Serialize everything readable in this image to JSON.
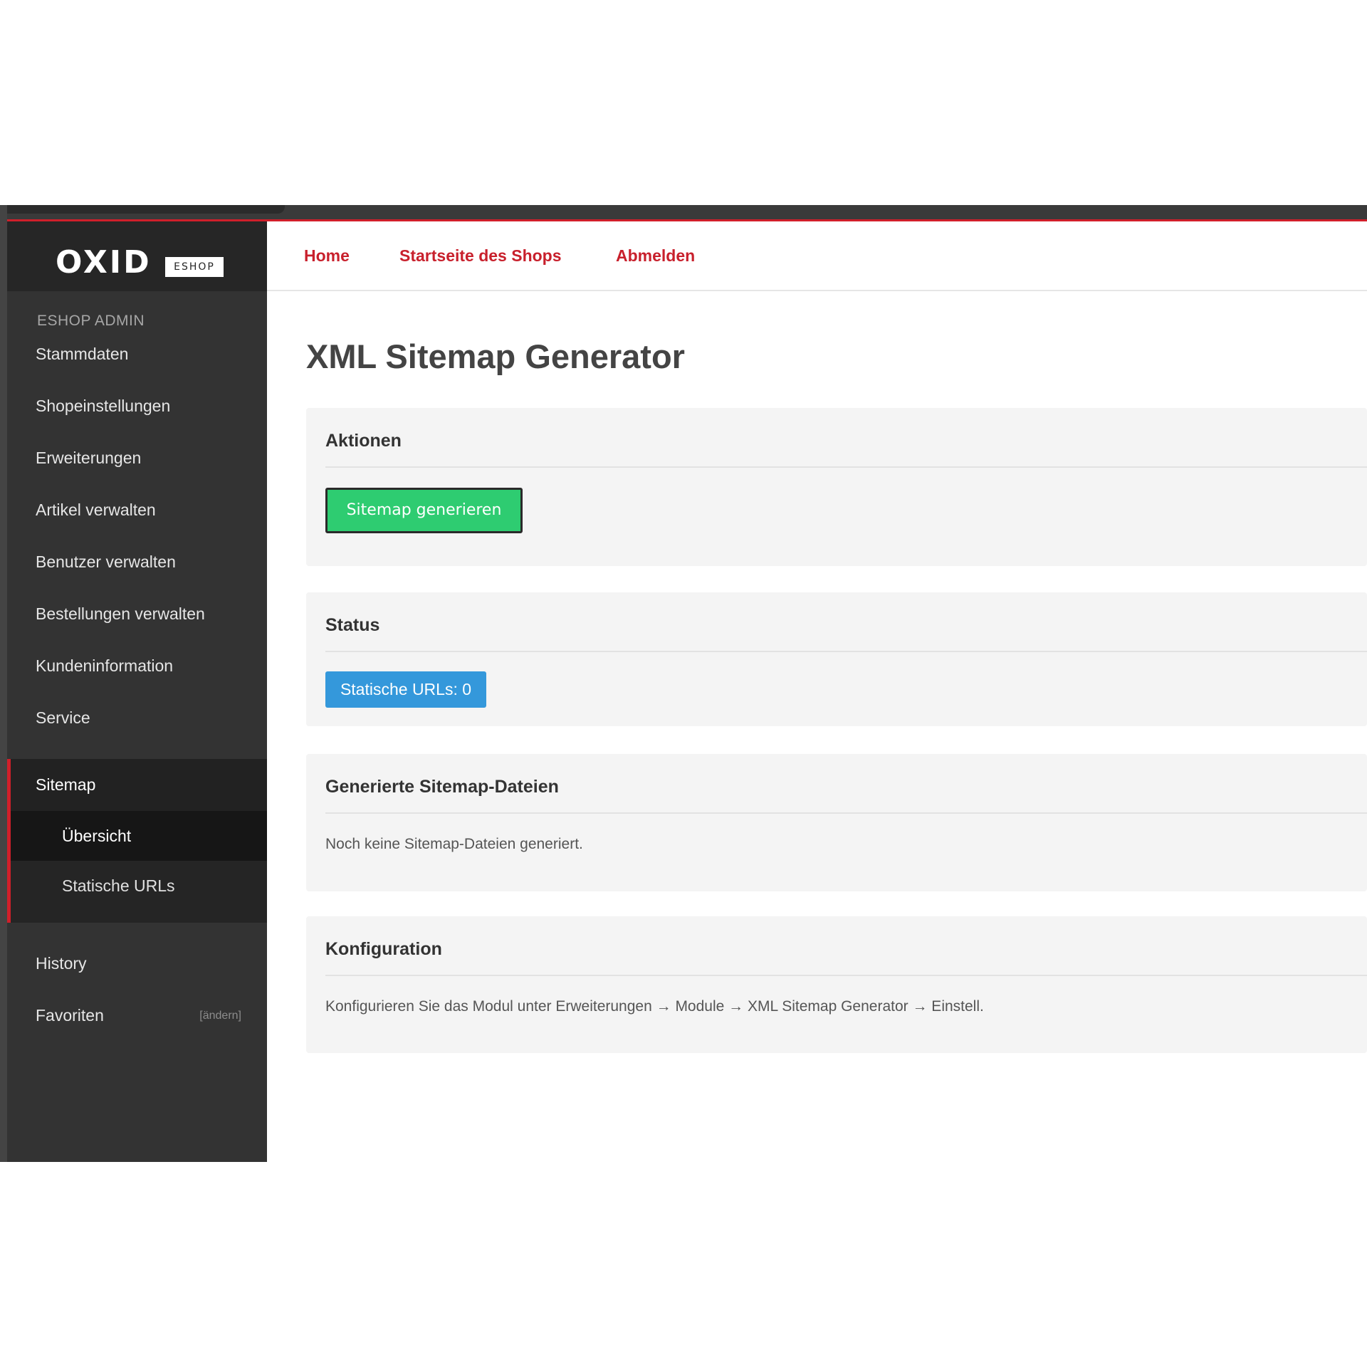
{
  "sidebar": {
    "logo_text": "OXID",
    "logo_badge": "ESHOP",
    "admin_label": "ESHOP ADMIN",
    "items": [
      {
        "label": "Stammdaten"
      },
      {
        "label": "Shopeinstellungen"
      },
      {
        "label": "Erweiterungen"
      },
      {
        "label": "Artikel verwalten"
      },
      {
        "label": "Benutzer verwalten"
      },
      {
        "label": "Bestellungen verwalten"
      },
      {
        "label": "Kundeninformation"
      },
      {
        "label": "Service"
      },
      {
        "label": "Sitemap"
      }
    ],
    "sub_items": [
      {
        "label": "Übersicht"
      },
      {
        "label": "Statische URLs"
      }
    ],
    "history_label": "History",
    "favorites_label": "Favoriten",
    "favorites_edit": "[ändern]"
  },
  "topnav": {
    "home": "Home",
    "shop_start": "Startseite des Shops",
    "logout": "Abmelden"
  },
  "main": {
    "title": "XML Sitemap Generator",
    "actions_panel": {
      "title": "Aktionen",
      "button_label": "Sitemap generieren"
    },
    "status_panel": {
      "title": "Status",
      "badge": "Statische URLs: 0"
    },
    "files_panel": {
      "title": "Generierte Sitemap-Dateien",
      "text": "Noch keine Sitemap-Dateien generiert."
    },
    "config_panel": {
      "title": "Konfiguration",
      "text": "Konfigurieren Sie das Modul unter Erweiterungen → Module → XML Sitemap Generator → Einstell."
    }
  },
  "colors": {
    "accent_red": "#d01f2a",
    "link_red": "#c8202c",
    "sidebar_bg": "#333333",
    "button_green": "#2ecc71",
    "badge_blue": "#3498db"
  }
}
